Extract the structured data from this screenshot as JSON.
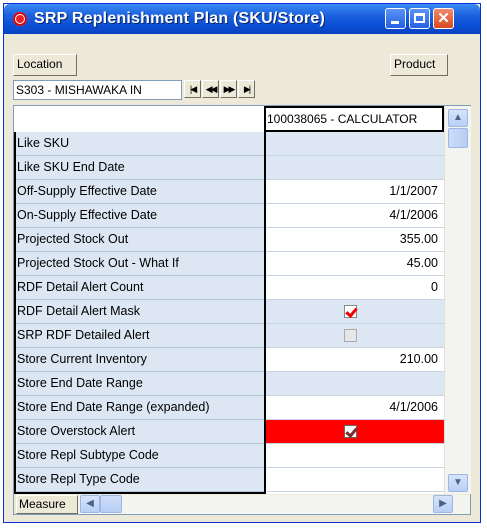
{
  "window": {
    "title": "SRP Replenishment Plan (SKU/Store)",
    "controls": {
      "minimize": "minimize-icon",
      "maximize": "maximize-icon",
      "close": "✕"
    }
  },
  "toolbar": {
    "location_label": "Location",
    "product_label": "Product",
    "location_value": "S303 - MISHAWAKA IN",
    "nav": [
      "|◀",
      "◀◀",
      "▶▶",
      "▶|"
    ]
  },
  "grid": {
    "column_header": "100038065 - CALCULATOR",
    "rows": [
      {
        "label": "Like SKU",
        "value": "",
        "style": "shaded"
      },
      {
        "label": "Like SKU End Date",
        "value": "",
        "style": "shaded"
      },
      {
        "label": "Off-Supply Effective Date",
        "value": "1/1/2007"
      },
      {
        "label": "On-Supply Effective Date",
        "value": "4/1/2006"
      },
      {
        "label": "Projected Stock Out",
        "value": "355.00"
      },
      {
        "label": "Projected Stock Out - What If",
        "value": "45.00"
      },
      {
        "label": "RDF Detail Alert Count",
        "value": "0"
      },
      {
        "label": "RDF Detail Alert Mask",
        "value": "",
        "checkbox": "checked",
        "style": "shaded"
      },
      {
        "label": "SRP RDF Detailed Alert",
        "value": "",
        "checkbox": "disabled",
        "style": "shaded"
      },
      {
        "label": "Store Current Inventory",
        "value": "210.00"
      },
      {
        "label": "Store End Date Range",
        "value": "",
        "style": "shaded"
      },
      {
        "label": "Store End Date Range (expanded)",
        "value": "4/1/2006"
      },
      {
        "label": "Store Overstock Alert",
        "value": "",
        "checkbox": "checked",
        "style": "red"
      },
      {
        "label": "Store Repl Subtype Code",
        "value": ""
      },
      {
        "label": "Store Repl Type Code",
        "value": ""
      }
    ]
  },
  "bottom": {
    "measure_label": "Measure"
  },
  "colors": {
    "title_bar": "#0a4fd6",
    "row_header_bg": "#dde7f4",
    "alert_red": "#ff0000"
  }
}
